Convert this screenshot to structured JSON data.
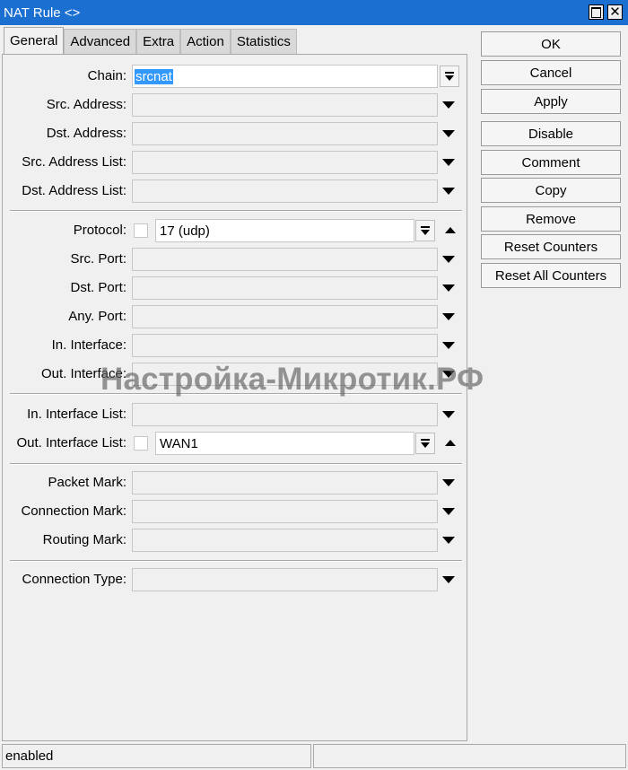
{
  "window": {
    "title": "NAT Rule <>",
    "maximize_icon": "maximize-icon",
    "close_icon": "close-icon",
    "close_glyph": "✕"
  },
  "tabs": [
    "General",
    "Advanced",
    "Extra",
    "Action",
    "Statistics"
  ],
  "active_tab": "General",
  "fields": {
    "chain": {
      "label": "Chain:",
      "value": "srcnat"
    },
    "src_address": {
      "label": "Src. Address:",
      "value": ""
    },
    "dst_address": {
      "label": "Dst. Address:",
      "value": ""
    },
    "src_address_list": {
      "label": "Src. Address List:",
      "value": ""
    },
    "dst_address_list": {
      "label": "Dst. Address List:",
      "value": ""
    },
    "protocol": {
      "label": "Protocol:",
      "value": "17 (udp)"
    },
    "src_port": {
      "label": "Src. Port:",
      "value": ""
    },
    "dst_port": {
      "label": "Dst. Port:",
      "value": ""
    },
    "any_port": {
      "label": "Any. Port:",
      "value": ""
    },
    "in_interface": {
      "label": "In. Interface:",
      "value": ""
    },
    "out_interface": {
      "label": "Out. Interface:",
      "value": ""
    },
    "in_interface_list": {
      "label": "In. Interface List:",
      "value": ""
    },
    "out_interface_list": {
      "label": "Out. Interface List:",
      "value": "WAN1"
    },
    "packet_mark": {
      "label": "Packet Mark:",
      "value": ""
    },
    "connection_mark": {
      "label": "Connection Mark:",
      "value": ""
    },
    "routing_mark": {
      "label": "Routing Mark:",
      "value": ""
    },
    "connection_type": {
      "label": "Connection Type:",
      "value": ""
    }
  },
  "buttons": {
    "ok": "OK",
    "cancel": "Cancel",
    "apply": "Apply",
    "disable": "Disable",
    "comment": "Comment",
    "copy": "Copy",
    "remove": "Remove",
    "reset_counters": "Reset Counters",
    "reset_all_counters": "Reset All Counters"
  },
  "watermark": "Настройка-Микротик.РФ",
  "status": {
    "left": "enabled",
    "right": ""
  },
  "colors": {
    "titlebar": "#1a6fd0",
    "selection": "#3399ff"
  }
}
